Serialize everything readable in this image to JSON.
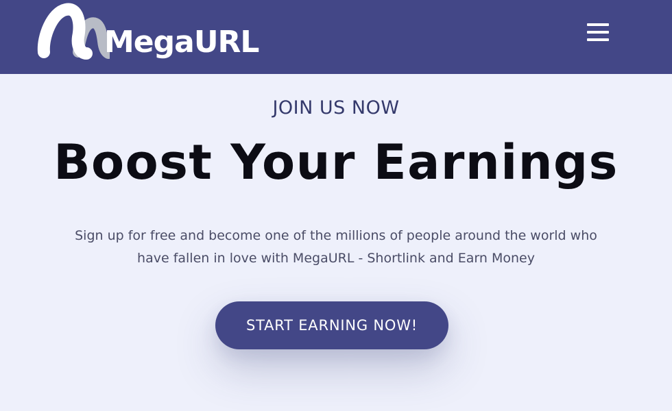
{
  "brand": {
    "name": "MegaURL",
    "text_color": "#ffffff",
    "mark_colors": [
      "#ffffff",
      "#b8bcc6"
    ]
  },
  "header": {
    "background": "#434787",
    "menu_icon": "hamburger-menu-icon"
  },
  "hero": {
    "eyebrow": "JOIN US NOW",
    "headline": "Boost Your Earnings",
    "subtext_line1": "Sign up for free and become one of the millions of people around the world who",
    "subtext_line2": "have fallen in love with MegaURL - Shortlink and Earn Money",
    "cta_label": "START EARNING NOW!",
    "background": "#eef0fb",
    "accent": "#434787"
  }
}
